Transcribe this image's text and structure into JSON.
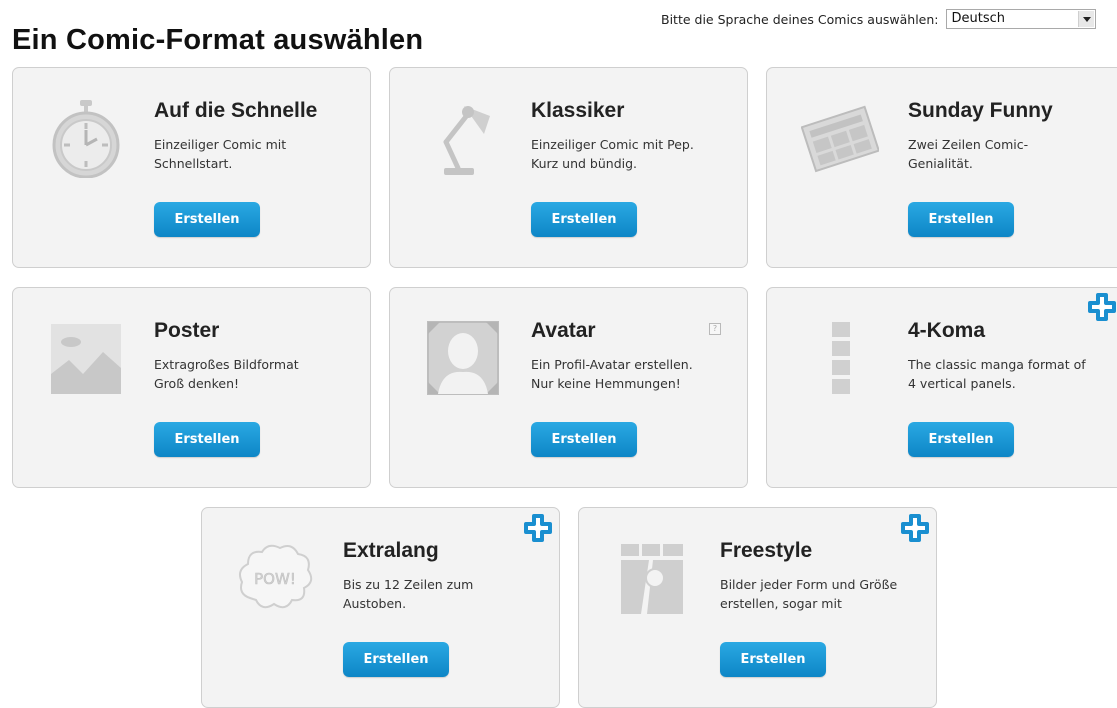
{
  "page_title": "Ein Comic-Format auswählen",
  "language": {
    "label": "Bitte die Sprache deines Comics auswählen:",
    "selected": "Deutsch"
  },
  "colors": {
    "button": "#1a96d4",
    "card_bg": "#f3f3f3",
    "plus_icon": "#1a8fd0"
  },
  "cards": [
    {
      "title": "Auf die Schnelle",
      "desc": [
        "Einzeiliger Comic mit",
        "Schnellstart."
      ],
      "button": "Erstellen",
      "icon": "stopwatch-icon"
    },
    {
      "title": "Klassiker",
      "desc": [
        "Einzeiliger Comic mit Pep.",
        "Kurz und bündig."
      ],
      "button": "Erstellen",
      "icon": "desk-lamp-icon"
    },
    {
      "title": "Sunday Funny",
      "desc": [
        "Zwei Zeilen Comic-",
        "Genialität."
      ],
      "button": "Erstellen",
      "icon": "newspaper-icon"
    },
    {
      "title": "Poster",
      "desc": [
        "Extragroßes Bildformat",
        "Groß denken!"
      ],
      "button": "Erstellen",
      "icon": "landscape-image-icon"
    },
    {
      "title": "Avatar",
      "desc": [
        "Ein Profil-Avatar erstellen.",
        "Nur keine Hemmungen!"
      ],
      "button": "Erstellen",
      "icon": "profile-avatar-icon",
      "help": "?"
    },
    {
      "title": "4-Koma",
      "desc": [
        "The classic manga format of",
        "4 vertical panels."
      ],
      "button": "Erstellen",
      "icon": "vertical-panels-icon",
      "badge": "plus-icon"
    },
    {
      "title": "Extralang",
      "desc": [
        "Bis zu 12 Zeilen zum",
        "Austoben."
      ],
      "button": "Erstellen",
      "icon": "pow-cloud-icon",
      "icon_text": "POW!",
      "badge": "plus-icon"
    },
    {
      "title": "Freestyle",
      "desc": [
        "Bilder jeder Form und Größe",
        "erstellen, sogar mit"
      ],
      "button": "Erstellen",
      "icon": "freestyle-panels-icon",
      "badge": "plus-icon"
    }
  ]
}
